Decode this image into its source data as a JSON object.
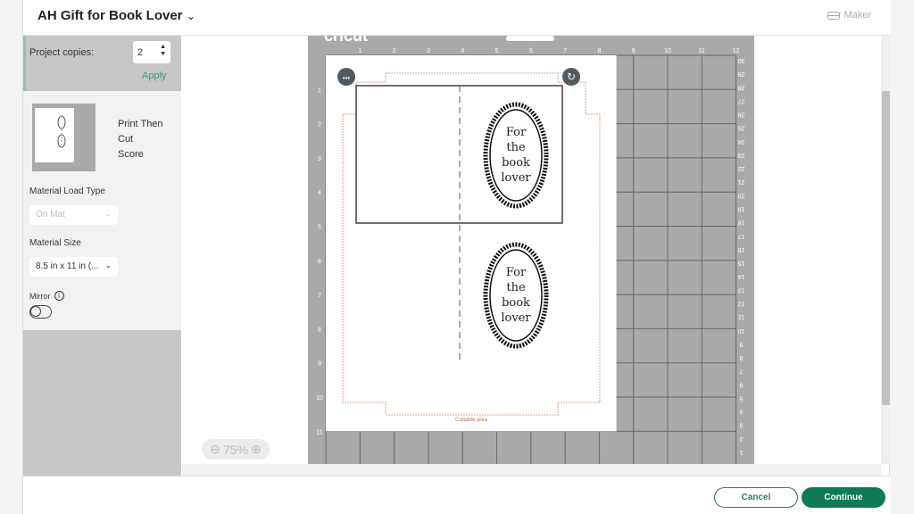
{
  "header": {
    "title": "AH Gift for Book Lover",
    "title_chevron": "chevron-down-icon",
    "machine_label": "Maker",
    "machine_icon": "cricut-machine-icon"
  },
  "left_panel": {
    "copies_label": "Project copies:",
    "copies_value": "2",
    "apply_label": "Apply",
    "modes": [
      "Print Then",
      "Cut",
      "Score"
    ],
    "material_load_label": "Material Load Type",
    "material_load_value": "On Mat",
    "material_size_label": "Material Size",
    "material_size_value": "8.5 in x 11 in (...",
    "mirror_label": "Mirror",
    "mirror_on": false
  },
  "mat": {
    "brand": "cricut",
    "top_ruler": [
      "1",
      "2",
      "3",
      "4",
      "5",
      "6",
      "7",
      "8",
      "9",
      "10",
      "11",
      "12"
    ],
    "left_ruler": [
      "1",
      "2",
      "3",
      "4",
      "5",
      "6",
      "7",
      "8",
      "9",
      "10",
      "11"
    ],
    "right_ruler": [
      "30",
      "29",
      "28",
      "27",
      "26",
      "25",
      "24",
      "23",
      "22",
      "21",
      "20",
      "19",
      "18",
      "17",
      "16",
      "15",
      "14",
      "13",
      "12",
      "11",
      "10",
      "9",
      "8",
      "7",
      "6",
      "5",
      "4",
      "3",
      "2",
      "1"
    ],
    "cuttable_label": "Cuttable area",
    "tag_text": [
      "For",
      "the",
      "book",
      "lover"
    ],
    "colors": {
      "mat": "#a9a9a9",
      "cuttable": "#d9a089"
    }
  },
  "zoom": {
    "value": "75%"
  },
  "footer": {
    "cancel_label": "Cancel",
    "continue_label": "Continue",
    "accent": "#0e7a57"
  }
}
